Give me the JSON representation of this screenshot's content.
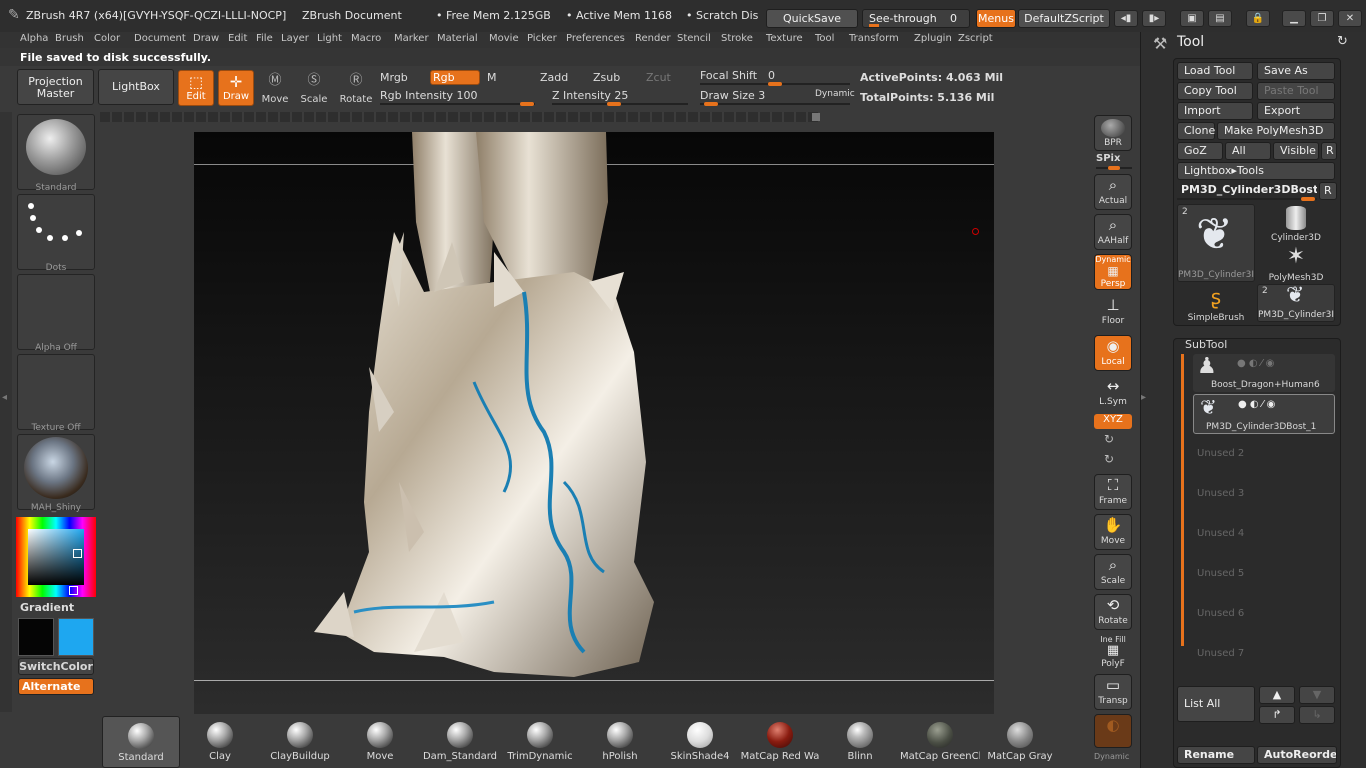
{
  "titlebar": {
    "app": "ZBrush 4R7 (x64)[GVYH-YSQF-QCZI-LLLI-NOCP]",
    "doc": "ZBrush Document",
    "free_mem": "• Free Mem 2.125GB",
    "active_mem": "• Active Mem 1168",
    "scratch": "• Scratch Dis",
    "quicksave": "QuickSave",
    "see_through": "See-through",
    "see_through_val": "0",
    "menus": "Menus",
    "script": "DefaultZScript"
  },
  "menu": [
    "Alpha",
    "Brush",
    "Color",
    "Document",
    "Draw",
    "Edit",
    "File",
    "Layer",
    "Light",
    "Macro",
    "Marker",
    "Material",
    "Movie",
    "Picker",
    "Preferences",
    "Render",
    "Stencil",
    "Stroke",
    "Texture",
    "Tool",
    "Transform",
    "Zplugin",
    "Zscript"
  ],
  "notice": "File saved to disk successfully.",
  "toolbar": {
    "projection": "Projection Master",
    "lightbox": "LightBox",
    "edit": "Edit",
    "draw": "Draw",
    "move": "Move",
    "scale": "Scale",
    "rotate": "Rotate",
    "mrgb": "Mrgb",
    "rgb": "Rgb",
    "m": "M",
    "zadd": "Zadd",
    "zsub": "Zsub",
    "zcut": "Zcut",
    "rgb_intensity": "Rgb Intensity 100",
    "z_intensity": "Z Intensity 25",
    "focal_shift": "Focal Shift",
    "focal_shift_val": "0",
    "draw_size": "Draw Size 3",
    "dynamic": "Dynamic",
    "active_points": "ActivePoints: 4.063  Mil",
    "total_points": "TotalPoints: 5.136  Mil"
  },
  "left": {
    "brush": "Standard",
    "stroke": "Dots",
    "alpha": "Alpha  Off",
    "texture": "Texture  Off",
    "material": "MAH_Shiny",
    "gradient": "Gradient",
    "switchcolor": "SwitchColor",
    "alternate": "Alternate"
  },
  "right": {
    "bpr": "BPR",
    "spix": "SPix",
    "actual": "Actual",
    "aahalf": "AAHalf",
    "dynamic": "Dynamic",
    "persp": "Persp",
    "floor": "Floor",
    "local": "Local",
    "lsym": "L.Sym",
    "xyz": "XYZ",
    "frame": "Frame",
    "move": "Move",
    "scale": "Scale",
    "rotate": "Rotate",
    "polyf": "PolyF",
    "line_fill": "Ine Fill",
    "transp": "Transp",
    "dynamic2": "Dynamic"
  },
  "panel": {
    "title": "Tool",
    "load": "Load Tool",
    "saveas": "Save As",
    "copy": "Copy Tool",
    "paste": "Paste Tool",
    "import": "Import",
    "export": "Export",
    "clone": "Clone",
    "make": "Make PolyMesh3D",
    "goz": "GoZ",
    "all": "All",
    "visible": "Visible",
    "r": "R",
    "lightbox_tools": "Lightbox▸Tools",
    "current": "PM3D_Cylinder3DBost_",
    "tools": [
      {
        "name": "PM3D_Cylinder3I",
        "count": "2"
      },
      {
        "name": "Cylinder3D",
        "count": ""
      },
      {
        "name": "PolyMesh3D",
        "count": ""
      },
      {
        "name": "SimpleBrush",
        "count": ""
      },
      {
        "name": "PM3D_Cylinder3I",
        "count": "2"
      }
    ],
    "subtool": "SubTool",
    "subtools": [
      "Boost_Dragon+Human6",
      "PM3D_Cylinder3DBost_1"
    ],
    "unused": [
      "Unused 2",
      "Unused 3",
      "Unused 4",
      "Unused 5",
      "Unused 6",
      "Unused 7"
    ],
    "list_all": "List All",
    "rename": "Rename",
    "autoreorder": "AutoReorder"
  },
  "materials": [
    "Standard",
    "Clay",
    "ClayBuildup",
    "Move",
    "Dam_Standard",
    "TrimDynamic",
    "hPolish",
    "SkinShade4",
    "MatCap Red Wa",
    "Blinn",
    "MatCap GreenCla",
    "MatCap Gray"
  ],
  "colors": {
    "accent": "#e7721c",
    "secondary_color": "#1ea7f0",
    "primary_color": "#050505"
  }
}
